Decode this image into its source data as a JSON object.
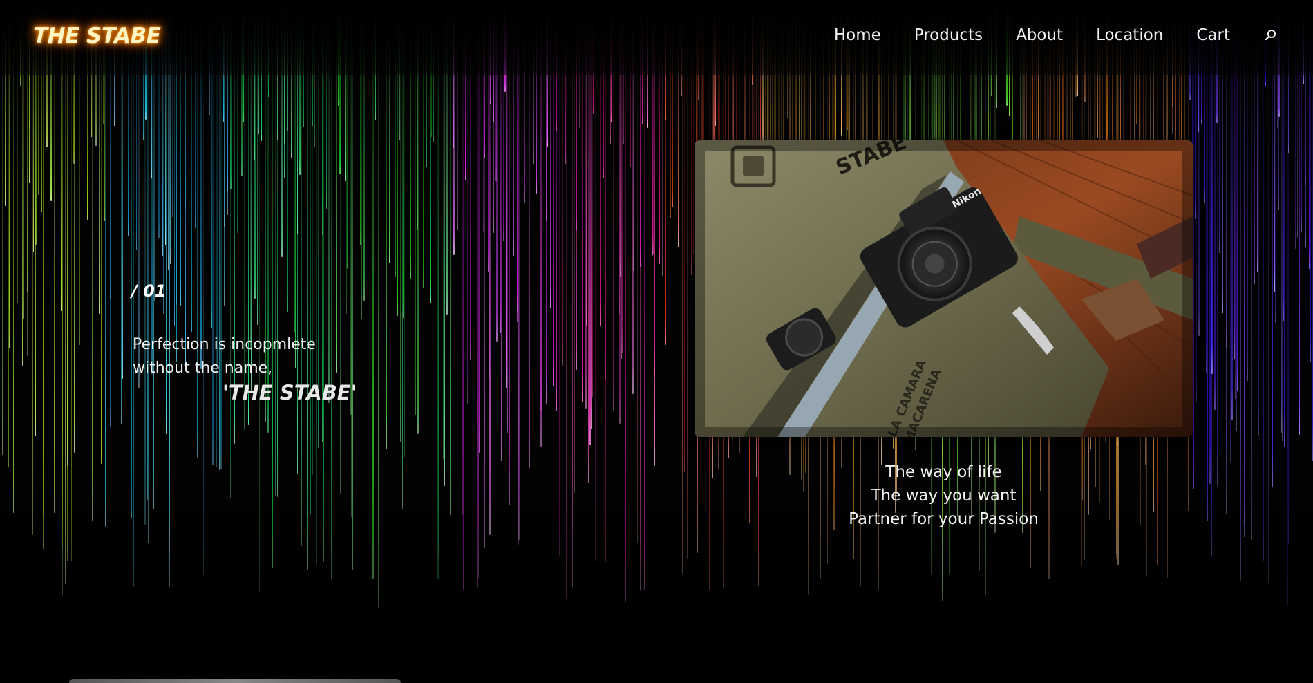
{
  "brand": {
    "logo_text": "THE STABE"
  },
  "nav": {
    "items": [
      {
        "label": "Home"
      },
      {
        "label": "Products"
      },
      {
        "label": "About"
      },
      {
        "label": "Location"
      },
      {
        "label": "Cart"
      }
    ],
    "search_icon": "search-icon"
  },
  "hero": {
    "slide_number": "/ 01",
    "tagline_line1": "Perfection is incopmlete",
    "tagline_line2": "without the name,",
    "brand_quote": "'THE STABE'"
  },
  "photo": {
    "subject": "camera-in-leather-bag",
    "bag_text": "STABE",
    "camera_brand": "Nikon",
    "bag_label_line1": "LA CAMARA",
    "bag_label_line2": "MACARENA"
  },
  "caption": {
    "line1": "The way of life",
    "line2": "The way you want",
    "line3": "Partner for your Passion"
  },
  "colors": {
    "logo_glow": "#ff8c00",
    "text": "#f3f3f3",
    "background": "#000000"
  }
}
